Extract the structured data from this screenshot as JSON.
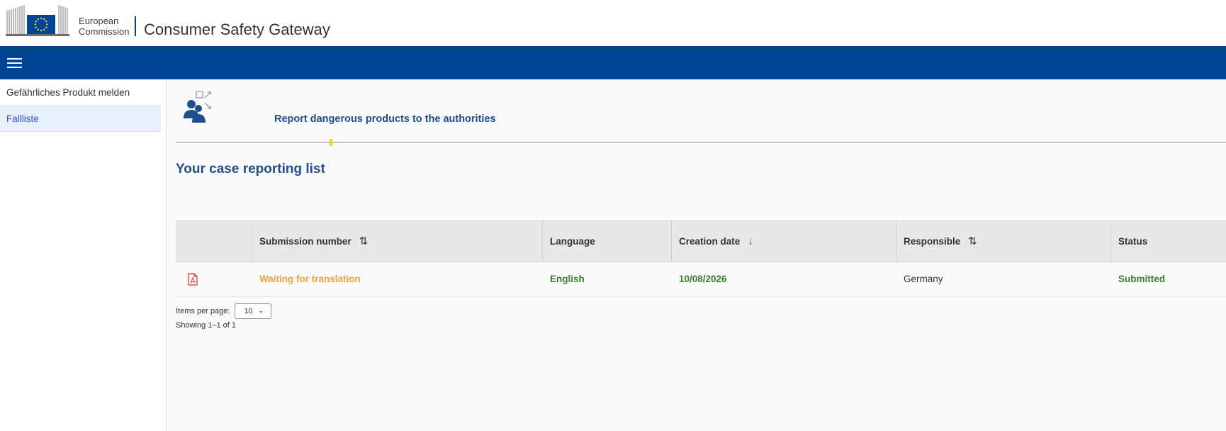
{
  "header": {
    "org_name_line1": "European",
    "org_name_line2": "Commission",
    "site_title": "Consumer Safety Gateway"
  },
  "navbar": {
    "menu_icon": "hamburger-menu-icon",
    "color": "#004494"
  },
  "sidebar": {
    "items": [
      {
        "label": "Gefährliches Produkt melden",
        "active": false
      },
      {
        "label": "Fallliste",
        "active": true
      }
    ]
  },
  "main": {
    "report_icon": "report-users-icon",
    "report_title": "Report dangerous products to the authorities",
    "page_title": "Your case reporting list"
  },
  "table": {
    "columns": [
      {
        "label": "",
        "sortable": false
      },
      {
        "label": "Submission number",
        "sortable": true,
        "sort_icon": "sort-both-icon"
      },
      {
        "label": "Language",
        "sortable": false
      },
      {
        "label": "Creation date",
        "sortable": true,
        "sort_icon": "sort-desc-icon"
      },
      {
        "label": "Responsible",
        "sortable": true,
        "sort_icon": "sort-both-icon"
      },
      {
        "label": "Status",
        "sortable": false
      }
    ],
    "rows": [
      {
        "icon": "pdf-icon",
        "submission_number": "Waiting for translation",
        "language": "English",
        "creation_date": "10/08/2026",
        "responsible": "Germany",
        "status": "Submitted"
      }
    ]
  },
  "pagination": {
    "items_per_page_label": "Items per page:",
    "items_per_page_value": "10",
    "showing": "Showing 1–1 of 1"
  },
  "colors": {
    "brand_blue": "#004494",
    "title_blue": "#1f4e8c",
    "pending_orange": "#f0a13a",
    "ok_green": "#3a7d2c"
  }
}
